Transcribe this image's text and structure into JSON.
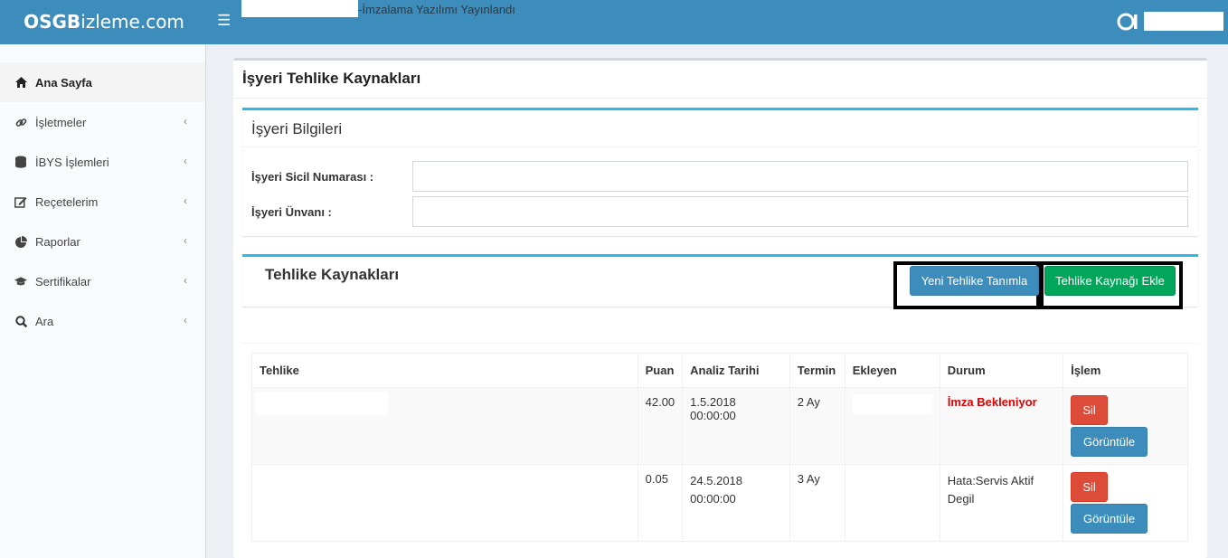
{
  "header": {
    "logo_bold": "OSGB",
    "logo_rest": "izleme.com",
    "menu_icon": "hamburger-icon",
    "announcement": "-İmzalama Yazılımı Yayınlandı",
    "brand_color": "#3c8dbc"
  },
  "sidebar": {
    "items": [
      {
        "label": "Ana Sayfa",
        "icon": "home-icon"
      },
      {
        "label": "İşletmeler",
        "icon": "link-icon"
      },
      {
        "label": "İBYS İşlemleri",
        "icon": "database-icon"
      },
      {
        "label": "Reçetelerim",
        "icon": "edit-icon"
      },
      {
        "label": "Raporlar",
        "icon": "pie-chart-icon"
      },
      {
        "label": "Sertifikalar",
        "icon": "graduation-cap-icon"
      },
      {
        "label": "Ara",
        "icon": "search-icon"
      }
    ]
  },
  "main": {
    "title": "İşyeri Tehlike Kaynakları",
    "info": {
      "title": "İşyeri Bilgileri",
      "sicil_label": "İşyeri Sicil Numarası :",
      "sicil_value": "",
      "unvan_label": "İşyeri Ünvanı :",
      "unvan_value": ""
    },
    "hazards": {
      "title": "Tehlike Kaynakları",
      "new_button": "Yeni Tehlike Tanımla",
      "add_button": "Tehlike Kaynağı Ekle"
    },
    "table": {
      "headers": [
        "Tehlike",
        "Puan",
        "Analiz Tarihi",
        "Termin",
        "Ekleyen",
        "Durum",
        "İşlem"
      ],
      "rows": [
        {
          "tehlike": "",
          "puan": "42.00",
          "tarih": "1.5.2018 00:00:00",
          "termin": "2 Ay",
          "ekleyen": "",
          "durum": "İmza Bekleniyor",
          "sil": "Sil",
          "goruntule": "Görüntüle"
        },
        {
          "tehlike": "",
          "puan": "0.05",
          "tarih": "24.5.2018 00:00:00",
          "termin": "3 Ay",
          "ekleyen": "",
          "durum": "Hata:Servis Aktif Degil",
          "sil": "Sil",
          "goruntule": "Görüntüle"
        }
      ]
    }
  }
}
